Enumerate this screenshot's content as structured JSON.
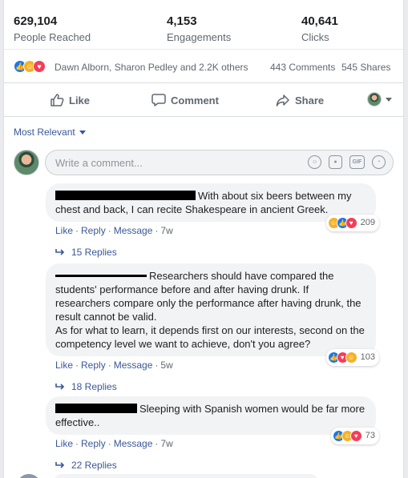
{
  "stats": [
    {
      "value": "629,104",
      "label": "People Reached"
    },
    {
      "value": "4,153",
      "label": "Engagements"
    },
    {
      "value": "40,641",
      "label": "Clicks"
    }
  ],
  "reactions_bar": {
    "icons": [
      "like-icon",
      "haha-icon",
      "love-icon"
    ],
    "names": "Dawn Alborn, Sharon Pedley and 2.2K others",
    "comments": "443 Comments",
    "shares": "545 Shares"
  },
  "actions": {
    "like": "Like",
    "comment": "Comment",
    "share": "Share"
  },
  "sort": {
    "label": "Most Relevant"
  },
  "composer": {
    "placeholder": "Write a comment..."
  },
  "comments": [
    {
      "text": "With about six beers between my chest and back, I can recite Shakespeare in ancient Greek.",
      "reaction_icons": [
        "haha-icon",
        "like-icon",
        "love-icon"
      ],
      "reaction_count": "209",
      "meta": {
        "like": "Like",
        "reply": "Reply",
        "message": "Message",
        "time": "7w"
      },
      "replies": "15 Replies"
    },
    {
      "text": "Researchers should have compared the students' performance before and after having drunk. If researchers compare only the performance after having drunk, the result cannot be valid.",
      "text2": "As for what to learn, it depends first on our interests, second on the competency level we want to achieve, don't you agree?",
      "reaction_icons": [
        "like-icon",
        "love-icon",
        "haha-icon"
      ],
      "reaction_count": "103",
      "meta": {
        "like": "Like",
        "reply": "Reply",
        "message": "Message",
        "time": "5w"
      },
      "replies": "18 Replies"
    },
    {
      "text": "Sleeping with Spanish women would be far more effective..",
      "reaction_icons": [
        "like-icon",
        "haha-icon",
        "love-icon"
      ],
      "reaction_count": "73",
      "meta": {
        "like": "Like",
        "reply": "Reply",
        "message": "Message",
        "time": "7w"
      },
      "replies": "22 Replies"
    }
  ],
  "colors": {
    "link": "#385898",
    "like": "#1877f2",
    "haha": "#f7b125",
    "love": "#f33e58",
    "bubble": "#f2f3f5"
  }
}
